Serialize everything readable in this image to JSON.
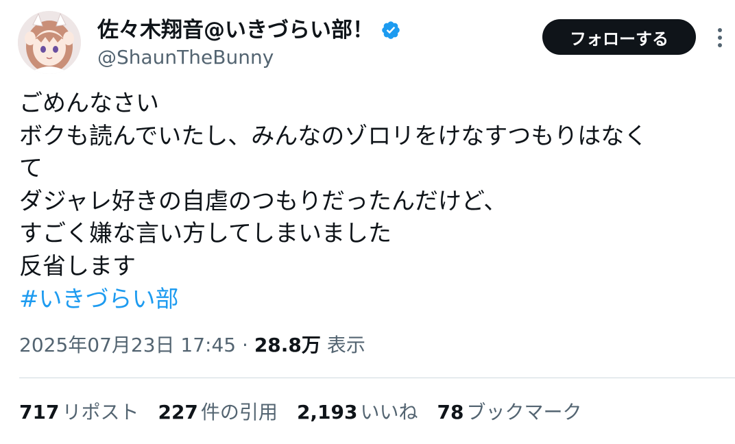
{
  "author": {
    "display_name": "佐々木翔音@いきづらい部！",
    "handle": "@ShaunTheBunny",
    "verified_icon": "verified-badge-icon"
  },
  "follow_button": {
    "label": "フォローする"
  },
  "tweet": {
    "lines": [
      "ごめんなさい",
      "ボクも読んでいたし、みんなのゾロリをけなすつもりはなく",
      "て",
      "ダジャレ好きの自虐のつもりだったんだけど、",
      "すごく嫌な言い方してしまいました",
      "反省します"
    ],
    "hashtag": "#いきづらい部"
  },
  "meta": {
    "timestamp": "2025年07月23日 17:45",
    "separator": "·",
    "views_count": "28.8万",
    "views_label": "表示"
  },
  "stats": [
    {
      "count": "717",
      "label": "リポスト"
    },
    {
      "count": "227",
      "label": "件の引用"
    },
    {
      "count": "2,193",
      "label": "いいね"
    },
    {
      "count": "78",
      "label": "ブックマーク"
    }
  ],
  "colors": {
    "text": "#0f1419",
    "secondary": "#536471",
    "link": "#1d9bf0",
    "verified": "#1d9bf0",
    "button_bg": "#0f1419",
    "divider": "#cfd9de"
  }
}
